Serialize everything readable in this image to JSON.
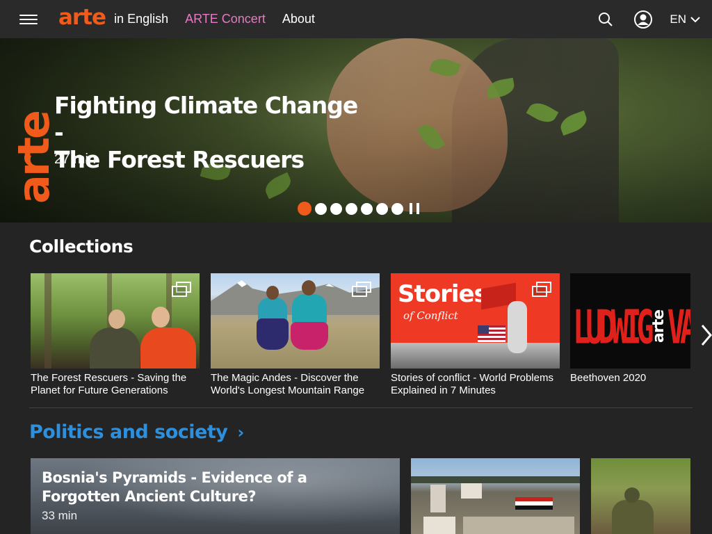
{
  "header": {
    "logo": "arte",
    "links": [
      "in English",
      "ARTE Concert",
      "About"
    ],
    "lang": "EN",
    "icons": [
      "menu-icon",
      "search-icon",
      "user-icon",
      "chevron-down-icon"
    ]
  },
  "hero": {
    "logo": "arte",
    "title_line1": "Fighting Climate Change -",
    "title_line2": "The Forest Rescuers",
    "duration": "27 min",
    "dots_count": 7,
    "active_dot": 1
  },
  "collections": {
    "title": "Collections",
    "items": [
      {
        "caption": "The Forest Rescuers - Saving the Planet for Future Generations"
      },
      {
        "caption": "The Magic Andes - Discover the World's Longest Mountain Range"
      },
      {
        "caption": "Stories of conflict - World Problems Explained in 7 Minutes",
        "thumb_title": "Stories",
        "thumb_sub": "of Conflict"
      },
      {
        "caption": "Beethoven 2020",
        "thumb_text": "LUDWIG",
        "thumb_logo": "arte",
        "thumb_suffix": "VA"
      }
    ]
  },
  "politics": {
    "title": "Politics and society",
    "featured_title": "Bosnia's Pyramids - Evidence of a Forgotten Ancient Culture?",
    "featured_duration": "33 min"
  },
  "colors": {
    "accent": "#f05a1a",
    "concert": "#e67ac4",
    "section_link": "#2e8fdc",
    "background": "#242424"
  }
}
